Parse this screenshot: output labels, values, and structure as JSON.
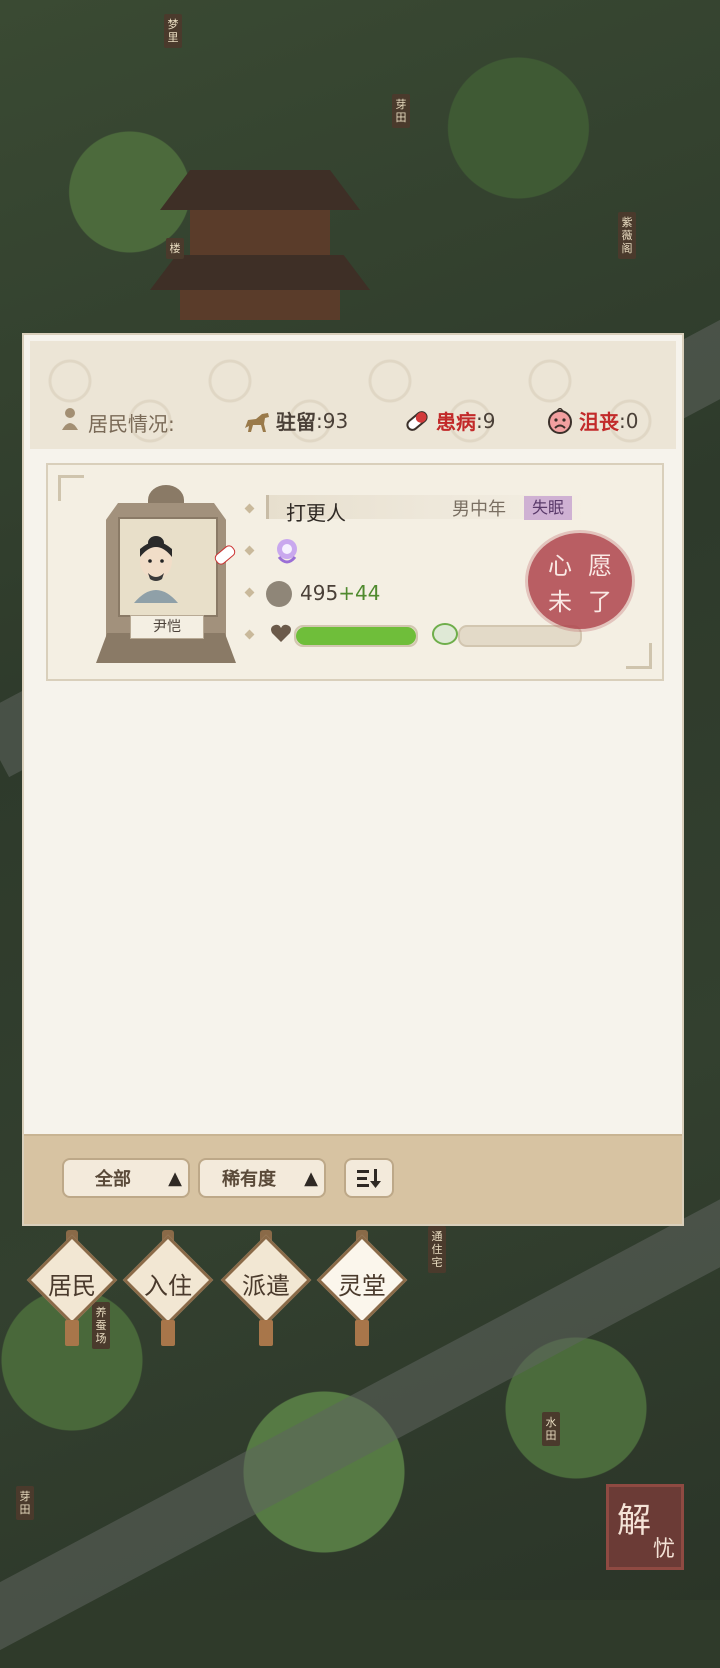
{
  "map": {
    "signs": [
      {
        "id": "sign-1",
        "text": "梦里"
      },
      {
        "id": "sign-2",
        "text": "芽田"
      },
      {
        "id": "sign-3",
        "text": "楼"
      },
      {
        "id": "sign-4",
        "text": "紫薇阁"
      },
      {
        "id": "sign-5",
        "text": "通住宅"
      },
      {
        "id": "sign-6",
        "text": "养蚕场"
      },
      {
        "id": "sign-7",
        "text": "水田"
      },
      {
        "id": "sign-8",
        "text": "芽田"
      }
    ]
  },
  "panel": {
    "status_label": "居民情况:",
    "stats": {
      "stay": {
        "label": "驻留",
        "value": ":93"
      },
      "sick": {
        "label": "患病",
        "value": ":9"
      },
      "sad": {
        "label": "沮丧",
        "value": ":0"
      }
    },
    "resident": {
      "name": "尹恺",
      "job": "打更人",
      "demographic": "男中年",
      "tag": "失眠",
      "coins": "495",
      "coin_bonus": "+44",
      "health_fraction": 1.0,
      "spirit_fraction": 0.0,
      "stamp": [
        "心",
        "愿",
        "未",
        "了"
      ]
    },
    "footer": {
      "filter_all": "全部",
      "filter_rarity": "稀有度",
      "order_icon": "sort-order-icon"
    }
  },
  "tabs": [
    {
      "id": "residents",
      "label": "居民"
    },
    {
      "id": "checkin",
      "label": "入住"
    },
    {
      "id": "dispatch",
      "label": "派遣"
    },
    {
      "id": "spirit-hall",
      "label": "灵堂"
    }
  ],
  "solve_button": {
    "c1": "解",
    "c2": "忧"
  }
}
